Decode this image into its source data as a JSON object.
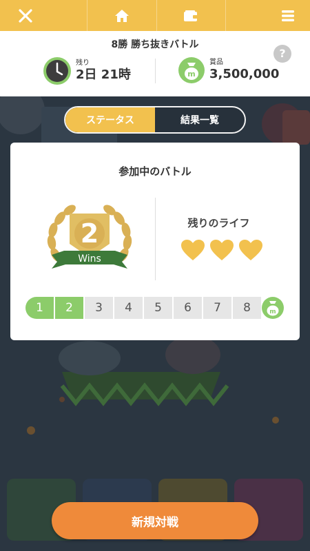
{
  "topbar": {
    "close_icon": "close-icon",
    "home_icon": "home-icon",
    "wallet_icon": "wallet-icon",
    "menu_icon": "menu-icon",
    "color": "#f2c14e"
  },
  "header": {
    "title": "8勝 勝ち抜きバトル",
    "remaining_label": "残り",
    "remaining_value": "2日 21時",
    "prize_label": "賞品",
    "prize_value": "3,500,000",
    "help_label": "?"
  },
  "tabs": [
    {
      "label": "ステータス",
      "active": true
    },
    {
      "label": "結果一覧",
      "active": false
    }
  ],
  "card": {
    "title": "参加中のバトル",
    "wins_number": "2",
    "wins_label": "Wins",
    "life_label": "残りのライフ",
    "lives": 3,
    "progress": {
      "steps": [
        "1",
        "2",
        "3",
        "4",
        "5",
        "6",
        "7",
        "8"
      ],
      "completed": 2
    }
  },
  "actions": {
    "new_battle": "新規対戦"
  },
  "colors": {
    "accent": "#f2c14e",
    "green": "#8ccc6a",
    "orange": "#ef8a3a",
    "heart": "#f2c14e"
  }
}
